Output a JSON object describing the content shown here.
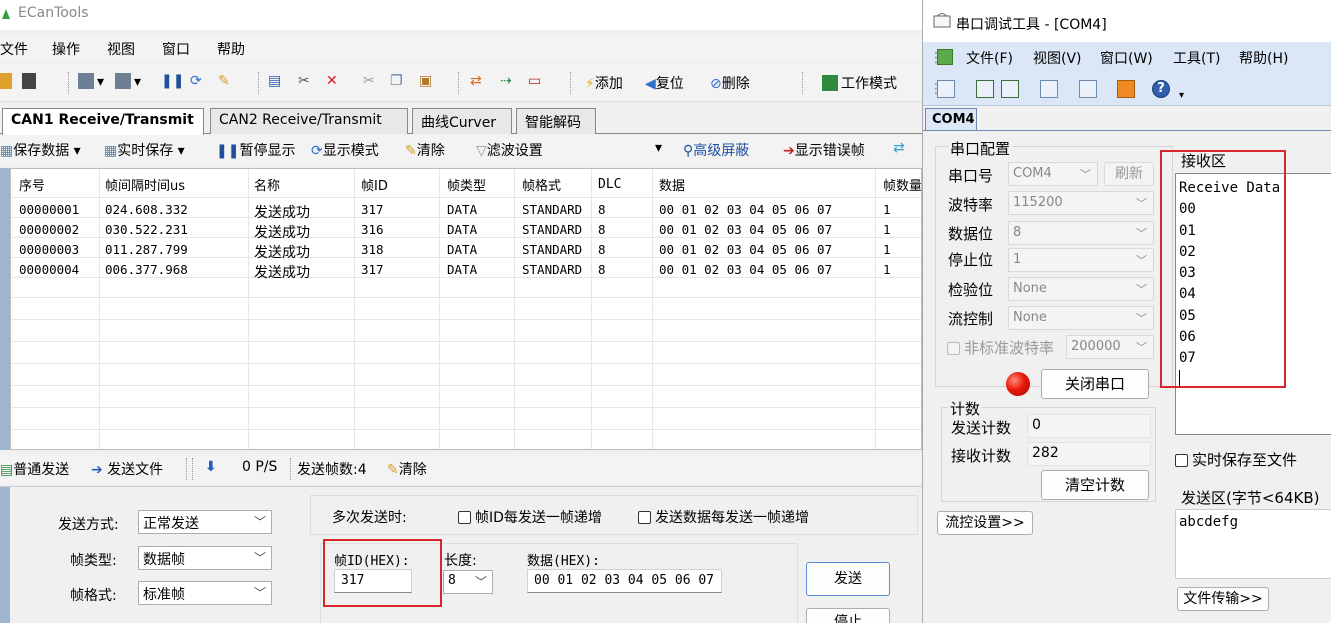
{
  "ecan": {
    "title": "ECanTools",
    "menu": [
      "文件",
      "操作",
      "视图",
      "窗口",
      "帮助"
    ],
    "toolbar": {
      "add": "添加",
      "reset": "复位",
      "delete": "删除",
      "work_mode": "工作模式"
    },
    "tabs": [
      "CAN1 Receive/Transmit",
      "CAN2 Receive/Transmit",
      "曲线Curver",
      "智能解码"
    ],
    "subtoolbar": {
      "save_data": "保存数据",
      "realtime_save": "实时保存",
      "pause_display": "暂停显示",
      "display_mode": "显示模式",
      "clear": "清除",
      "filter_settings": "滤波设置",
      "advanced_mask": "高级屏蔽",
      "show_error_frames": "显示错误帧"
    },
    "grid": {
      "headers": [
        "序号",
        "帧间隔时间us",
        "名称",
        "帧ID",
        "帧类型",
        "帧格式",
        "DLC",
        "数据",
        "帧数量"
      ],
      "rows": [
        [
          "00000001",
          "024.608.332",
          "发送成功",
          "317",
          "DATA",
          "STANDARD",
          "8",
          "00 01 02 03 04 05 06 07",
          "1"
        ],
        [
          "00000002",
          "030.522.231",
          "发送成功",
          "316",
          "DATA",
          "STANDARD",
          "8",
          "00 01 02 03 04 05 06 07",
          "1"
        ],
        [
          "00000003",
          "011.287.799",
          "发送成功",
          "318",
          "DATA",
          "STANDARD",
          "8",
          "00 01 02 03 04 05 06 07",
          "1"
        ],
        [
          "00000004",
          "006.377.968",
          "发送成功",
          "317",
          "DATA",
          "STANDARD",
          "8",
          "00 01 02 03 04 05 06 07",
          "1"
        ]
      ]
    },
    "sendbar": {
      "normal_send": "普通发送",
      "send_file": "发送文件",
      "rate": "0 P/S",
      "sent_frames": "发送帧数:4",
      "clear": "清除"
    },
    "sendpanel": {
      "send_mode_label": "发送方式:",
      "send_mode_value": "正常发送",
      "frame_type_label": "帧类型:",
      "frame_type_value": "数据帧",
      "frame_format_label": "帧格式:",
      "frame_format_value": "标准帧",
      "multi_send_label": "多次发送时:",
      "id_increment": "帧ID每发送一帧递增",
      "data_increment": "发送数据每发送一帧递增",
      "frame_id_label": "帧ID(HEX):",
      "frame_id_value": "317",
      "length_label": "长度:",
      "length_value": "8",
      "data_label": "数据(HEX):",
      "data_value": "00 01 02 03 04 05 06 07",
      "send_button": "发送",
      "stop_button": "停止"
    }
  },
  "serial": {
    "title": "串口调试工具 - [COM4]",
    "menu": [
      "文件(F)",
      "视图(V)",
      "窗口(W)",
      "工具(T)",
      "帮助(H)"
    ],
    "tab": "COM4",
    "config": {
      "group_label": "串口配置",
      "port_label": "串口号",
      "port_value": "COM4",
      "refresh": "刷新",
      "baud_label": "波特率",
      "baud_value": "115200",
      "databits_label": "数据位",
      "databits_value": "8",
      "stopbits_label": "停止位",
      "stopbits_value": "1",
      "parity_label": "检验位",
      "parity_value": "None",
      "flow_label": "流控制",
      "flow_value": "None",
      "nonstd_label": "非标准波特率",
      "nonstd_value": "200000",
      "close_port": "关闭串口"
    },
    "counter": {
      "group_label": "计数",
      "sent_label": "发送计数",
      "sent_value": "0",
      "recv_label": "接收计数",
      "recv_value": "282",
      "clear": "清空计数"
    },
    "flow_settings": "流控设置>>",
    "receive": {
      "label": "接收区",
      "lines": [
        "Receive Data",
        "00",
        "01",
        "02",
        "03",
        "04",
        "05",
        "06",
        "07"
      ]
    },
    "realtime_save": "实时保存至文件",
    "send": {
      "label": "发送区(字节<64KB)",
      "value": "abcdefg"
    },
    "file_transfer": "文件传输>>"
  }
}
